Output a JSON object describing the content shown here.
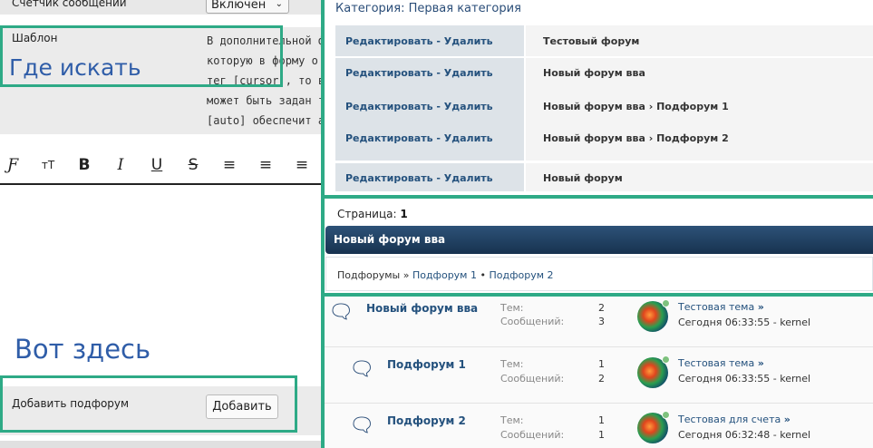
{
  "left": {
    "counter_label": "Счетчик сообщений",
    "counter_value": "Включен",
    "template_label": "Шаблон",
    "template_lines": [
      "В дополнительной ф",
      "которую в форму о",
      "тег [cursor], то в эт",
      "может быть задан т",
      "[auto] обеспечит ав"
    ],
    "annotation_top": "Где искать",
    "annotation_bottom": "Вот здесь",
    "add_label": "Добавить подфорум",
    "add_button": "Добавить",
    "toolbar": [
      "font-icon",
      "text-size-icon",
      "bold-icon",
      "italic-icon",
      "underline-icon",
      "strikethrough-icon",
      "align-left-icon",
      "align-center-icon",
      "align-right-icon"
    ],
    "toolbar_glyphs": [
      "Ƒ",
      "тТ",
      "B",
      "I",
      "U",
      "S",
      "≡",
      "≡",
      "≡"
    ]
  },
  "right": {
    "category_title": "Категория: Первая категория",
    "edit_delete": "Редактировать - Удалить",
    "forums": [
      "Тестовый форум",
      "Новый форум вва",
      "Новый форум вва › Подфорум 1",
      "Новый форум вва › Подфорум 2",
      "Новый форум"
    ],
    "page_label": "Страница:",
    "page_number": "1",
    "forum_header": "Новый форум вва",
    "subforums_label": "Подфорумы »",
    "subforum_1": "Подфорум 1",
    "subforum_sep": "•",
    "subforum_2": "Подфорум 2",
    "stat_topics": "Тем:",
    "stat_posts": "Сообщений:",
    "list": [
      {
        "name": "Новый форум вва",
        "topics": "2",
        "posts": "3",
        "last_topic": "Тестовая тема",
        "arrow": "»",
        "last_time": "Сегодня 06:33:55 - kernel"
      },
      {
        "name": "Подфорум 1",
        "topics": "1",
        "posts": "2",
        "last_topic": "Тестовая тема",
        "arrow": "»",
        "last_time": "Сегодня 06:33:55 - kernel"
      },
      {
        "name": "Подфорум 2",
        "topics": "1",
        "posts": "1",
        "last_topic": "Тестовая для счета",
        "arrow": "»",
        "last_time": "Сегодня 06:32:48 - kernel"
      }
    ]
  },
  "colors": {
    "annotation_green": "#2eaa86",
    "annotation_blue": "#2f5da8",
    "link": "#24517d",
    "header_bg": "#1f3d5f"
  }
}
